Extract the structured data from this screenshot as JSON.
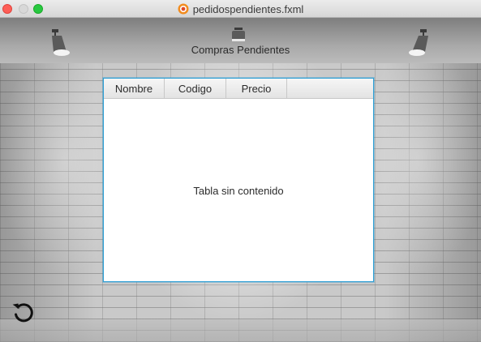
{
  "window": {
    "title": "pedidospendientes.fxml",
    "title_icon": "java-fxml-icon"
  },
  "heading": "Compras Pendientes",
  "table": {
    "columns": [
      "Nombre",
      "Codigo",
      "Precio"
    ],
    "rows": [],
    "placeholder": "Tabla sin contenido"
  },
  "actions": {
    "refresh_icon": "refresh-icon"
  },
  "colors": {
    "table_focus_border": "#2f9fd4",
    "close": "#fe5f57",
    "minimize_inactive": "#d8d8d8",
    "maximize": "#28c840"
  }
}
